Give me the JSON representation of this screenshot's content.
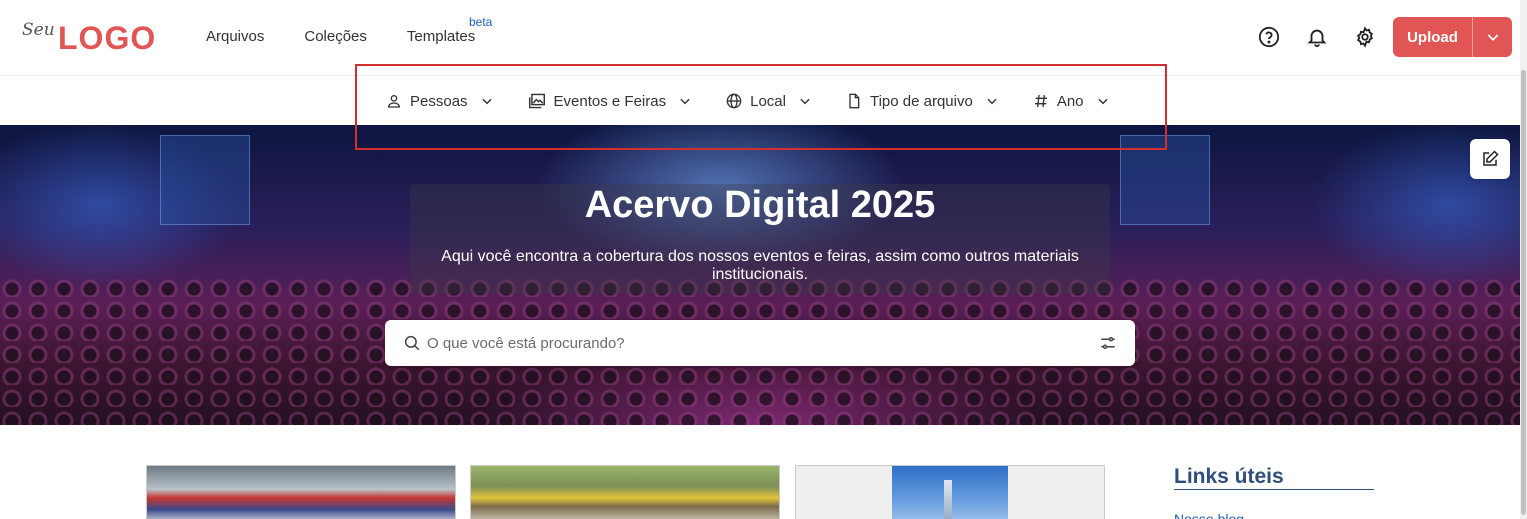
{
  "logo": {
    "prefix": "Seu",
    "mark": "LOGO"
  },
  "nav": {
    "links": [
      {
        "label": "Arquivos"
      },
      {
        "label": "Coleções"
      },
      {
        "label": "Templates"
      }
    ],
    "beta_badge": "beta"
  },
  "top_icons": [
    "help-circle-icon",
    "bell-icon",
    "gear-icon"
  ],
  "upload": {
    "label": "Upload"
  },
  "filters": [
    {
      "label": "Pessoas",
      "icon": "person-icon"
    },
    {
      "label": "Eventos e Feiras",
      "icon": "gallery-icon"
    },
    {
      "label": "Local",
      "icon": "globe-icon"
    },
    {
      "label": "Tipo de arquivo",
      "icon": "file-icon"
    },
    {
      "label": "Ano",
      "icon": "hash-icon"
    }
  ],
  "hero": {
    "title": "Acervo Digital 2025",
    "subtitle": "Aqui você encontra a cobertura dos nossos eventos e feiras, assim como outros materiais institucionais."
  },
  "search": {
    "placeholder": "O que você está procurando?"
  },
  "sidebar": {
    "title": "Links úteis",
    "items": [
      {
        "label": "Nosso blog"
      }
    ]
  },
  "colors": {
    "brand": "#e25555",
    "outline": "#d32f2f",
    "link": "#1f5fbf",
    "heading": "#2f4d7d"
  }
}
